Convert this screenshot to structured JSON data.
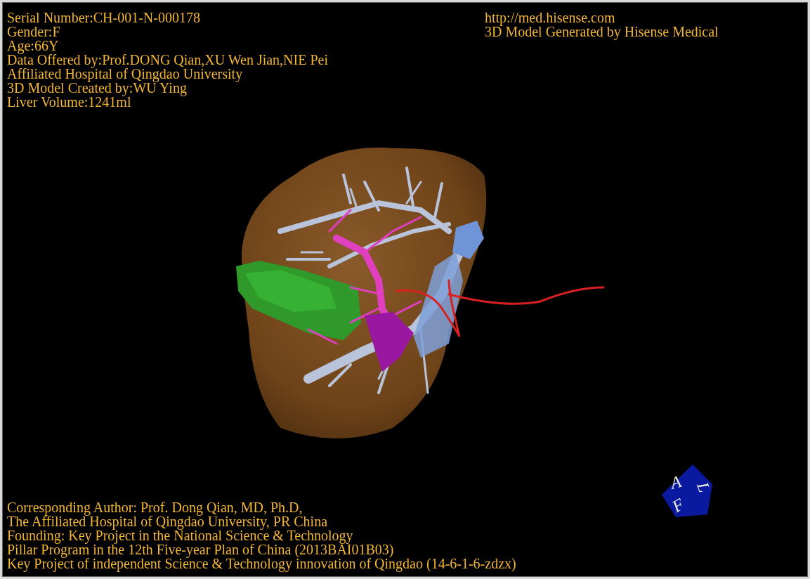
{
  "info_lines": [
    "Serial Number:CH-001-N-000178",
    "Gender:F",
    "Age:66Y",
    "Data Offered by:Prof.DONG Qian,XU Wen Jian,NIE Pei",
    "Affiliated Hospital of Qingdao University",
    "3D Model Created by:WU Ying",
    "Liver Volume:1241ml"
  ],
  "header_right": [
    "http://med.hisense.com",
    "3D Model Generated by Hisense Medical"
  ],
  "footer_lines": [
    "Corresponding Author: Prof. Dong Qian, MD, Ph.D,",
    "The Affiliated Hospital of Qingdao University, PR China",
    "Founding: Key Project in the National Science & Technology",
    "Pillar Program in the 12th Five-year Plan of China (2013BAI01B03)",
    "Key Project of independent Science & Technology innovation of Qingdao (14-6-1-6-zdzx)"
  ],
  "orientation_cube": {
    "labels": [
      "A",
      "L",
      "F"
    ]
  }
}
